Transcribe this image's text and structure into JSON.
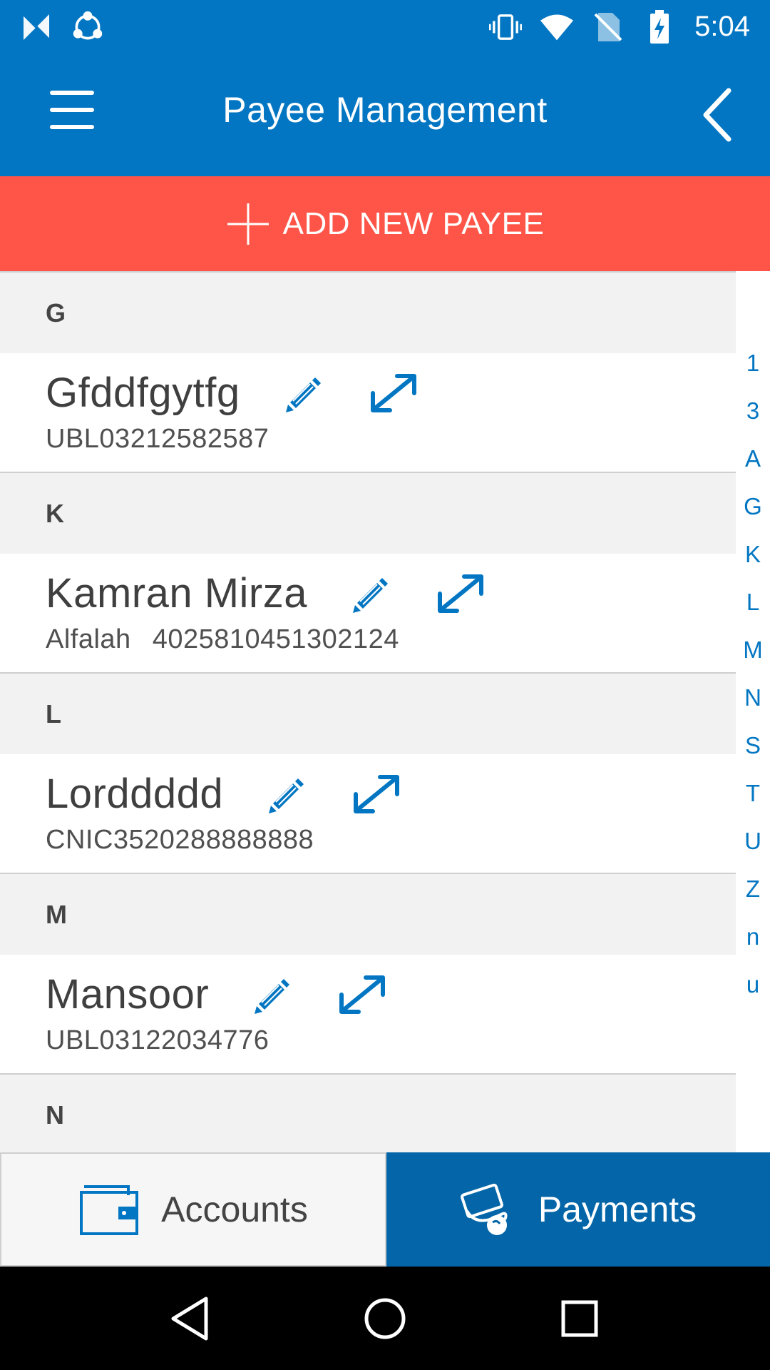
{
  "status_bar": {
    "time": "5:04",
    "left_icons": [
      "n-notification-icon",
      "share-app-icon"
    ],
    "right_icons": [
      "vibrate-icon",
      "wifi-icon",
      "no-sim-icon",
      "battery-charging-icon"
    ]
  },
  "header": {
    "title": "Payee Management",
    "menu_icon": "hamburger-menu-icon",
    "back_icon": "chevron-left-icon"
  },
  "add_payee": {
    "label": "ADD NEW PAYEE",
    "icon": "plus-icon"
  },
  "sections": [
    {
      "letter": "G",
      "payees": [
        {
          "name": "Gfddfgytfg",
          "bank": "",
          "account": "UBL03212582587"
        }
      ]
    },
    {
      "letter": "K",
      "payees": [
        {
          "name": "Kamran Mirza",
          "bank": "Alfalah",
          "account": "4025810451302124"
        }
      ]
    },
    {
      "letter": "L",
      "payees": [
        {
          "name": "Lorddddd",
          "bank": "",
          "account": "CNIC3520288888888"
        }
      ]
    },
    {
      "letter": "M",
      "payees": [
        {
          "name": "Mansoor",
          "bank": "",
          "account": "UBL03122034776"
        }
      ]
    },
    {
      "letter": "N",
      "payees": []
    }
  ],
  "index_letters": [
    "1",
    "3",
    "A",
    "G",
    "K",
    "L",
    "M",
    "N",
    "S",
    "T",
    "U",
    "Z",
    "n",
    "u"
  ],
  "tabs": [
    {
      "label": "Accounts",
      "icon": "wallet-icon",
      "active": false
    },
    {
      "label": "Payments",
      "icon": "hand-payment-icon",
      "active": true
    }
  ],
  "nav": [
    "back-triangle-icon",
    "home-circle-icon",
    "recents-square-icon"
  ],
  "colors": {
    "primary": "#0276c2",
    "accent": "#fe5548",
    "active_tab": "#0466a8",
    "section_bg": "#f2f2f2",
    "text": "#3f3f3f"
  }
}
